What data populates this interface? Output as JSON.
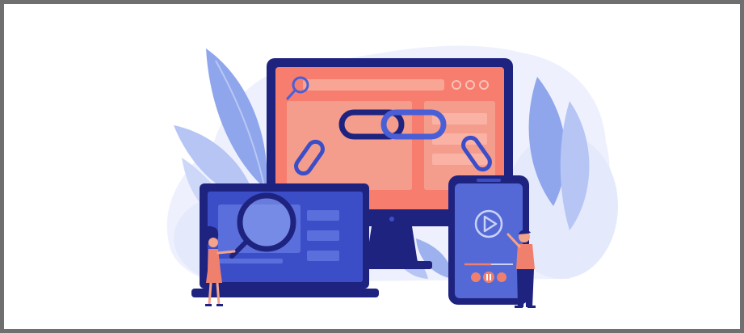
{
  "image": {
    "kind": "flat-illustration",
    "colors": {
      "border": "#6f6f6f",
      "background": "#ffffff",
      "leaf_light": "#dfe5fb",
      "leaf_blue": "#8aa2ec",
      "navy": "#1f2380",
      "screen_coral": "#f77d6e",
      "screen_panel": "#f59d8c",
      "chain_blue": "#4a5fd6",
      "laptop_screen": "#3c4ec7",
      "phone_screen": "#5569d6",
      "skin": "#f3a48a",
      "shirt": "#f0806e"
    },
    "icons": [
      "magnifier-icon",
      "chain-link-icon",
      "play-icon",
      "rewind-icon",
      "pause-icon",
      "forward-icon"
    ]
  }
}
